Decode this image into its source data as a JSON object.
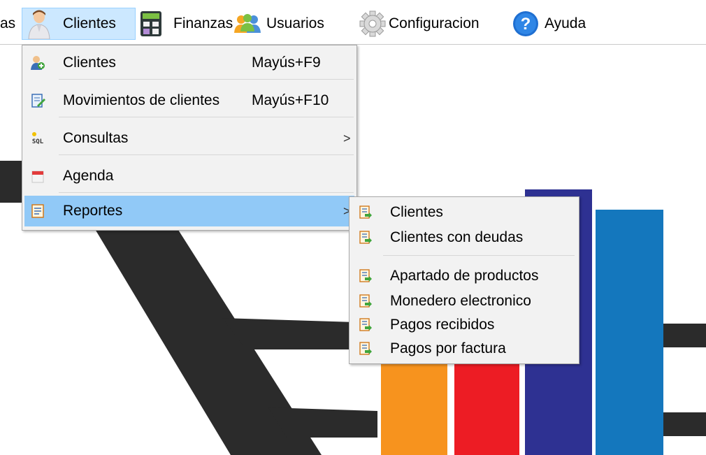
{
  "menubar": {
    "items": [
      {
        "label": "as",
        "icon": "truncated-menu"
      },
      {
        "label": "Clientes",
        "icon": "person-icon",
        "active": true
      },
      {
        "label": "Finanzas",
        "icon": "calculator-icon"
      },
      {
        "label": "Usuarios",
        "icon": "users-icon"
      },
      {
        "label": "Configuracion",
        "icon": "gear-icon"
      },
      {
        "label": "Ayuda",
        "icon": "help-icon"
      }
    ]
  },
  "dropdown": {
    "items": [
      {
        "label": "Clientes",
        "shortcut": "Mayús+F9",
        "icon": "client-add-icon"
      },
      {
        "label": "Movimientos de clientes",
        "shortcut": "Mayús+F10",
        "icon": "edit-document-icon"
      },
      {
        "label": "Consultas",
        "submenu_arrow": ">",
        "icon": "sql-icon"
      },
      {
        "label": "Agenda",
        "icon": "calendar-icon"
      },
      {
        "label": "Reportes",
        "submenu_arrow": ">",
        "icon": "report-icon",
        "highlighted": true
      }
    ]
  },
  "submenu": {
    "items": [
      {
        "label": "Clientes",
        "icon": "report-export-icon"
      },
      {
        "label": "Clientes con deudas",
        "icon": "report-export-icon"
      },
      {
        "label": "Apartado de productos",
        "icon": "report-export-icon"
      },
      {
        "label": "Monedero electronico",
        "icon": "report-export-icon"
      },
      {
        "label": "Pagos recibidos",
        "icon": "report-export-icon"
      },
      {
        "label": "Pagos por factura",
        "icon": "report-export-icon"
      }
    ]
  },
  "colors": {
    "menu_bg": "#f2f2f2",
    "highlight": "#91c9f7",
    "active_bar_item": "#cce8ff",
    "bg_dark": "#2b2b2b",
    "bar_orange": "#f7931e",
    "bar_red": "#ed1c24",
    "bar_navy": "#2e3192",
    "bar_blue": "#1477bd"
  }
}
